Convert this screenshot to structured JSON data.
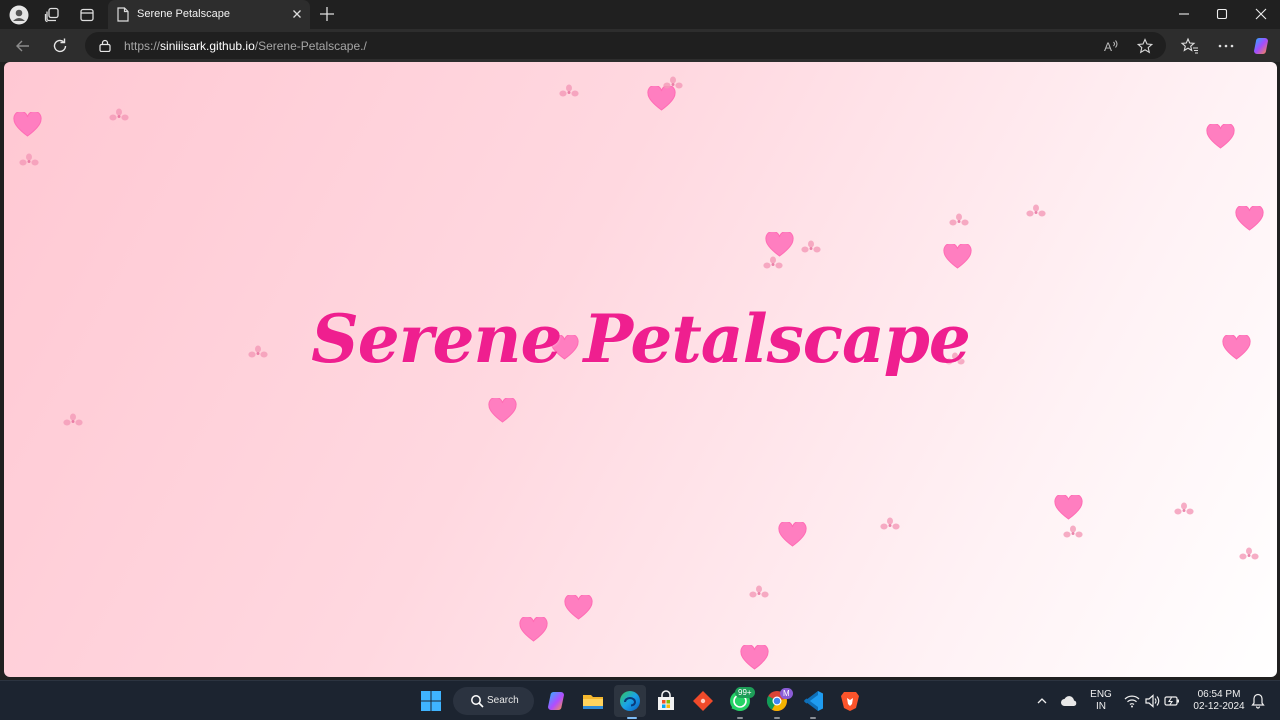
{
  "browser": {
    "tab": {
      "title": "Serene Petalscape",
      "favicon": "page-icon",
      "close_icon": "close-icon"
    },
    "titlebar_icons": [
      "profile-icon",
      "workspaces-icon",
      "tab-actions-icon"
    ],
    "new_tab_icon": "plus-icon",
    "window_controls": [
      "minimize-icon",
      "maximize-icon",
      "close-icon"
    ],
    "toolbar_icons": [
      "back-icon",
      "refresh-icon"
    ],
    "address": {
      "scheme": "https://",
      "host": "siniiisark.github.io",
      "path": "/Serene-Petalscape./",
      "lock_icon": "lock-icon"
    },
    "address_right_icons": [
      "read-aloud-icon",
      "favorite-star-icon"
    ],
    "right_icons": [
      "favorites-icon",
      "more-icon",
      "copilot-icon"
    ]
  },
  "page": {
    "title": "Serene Petalscape",
    "colors": {
      "title": "#ef1f8f",
      "heart": "#ff7ec0",
      "petal": "#f49ab8",
      "bg_start": "#ffc8d3",
      "bg_end": "#ffffff"
    }
  },
  "taskbar": {
    "search_label": "Search",
    "apps": [
      "windows-start-icon",
      "search-icon",
      "copilot-icon",
      "file-explorer-icon",
      "edge-icon",
      "store-icon",
      "git-diamond-icon",
      "whatsapp-icon",
      "chrome-icon",
      "vscode-icon",
      "brave-icon"
    ],
    "whatsapp_badge": "99+",
    "chrome_badge": "M",
    "tray": {
      "lang_top": "ENG",
      "lang_bottom": "IN",
      "time": "06:54 PM",
      "date": "02-12-2024",
      "icons": [
        "chevron-up-icon",
        "cloud-icon",
        "wifi-icon",
        "volume-icon",
        "battery-icon",
        "notification-icon"
      ]
    }
  }
}
